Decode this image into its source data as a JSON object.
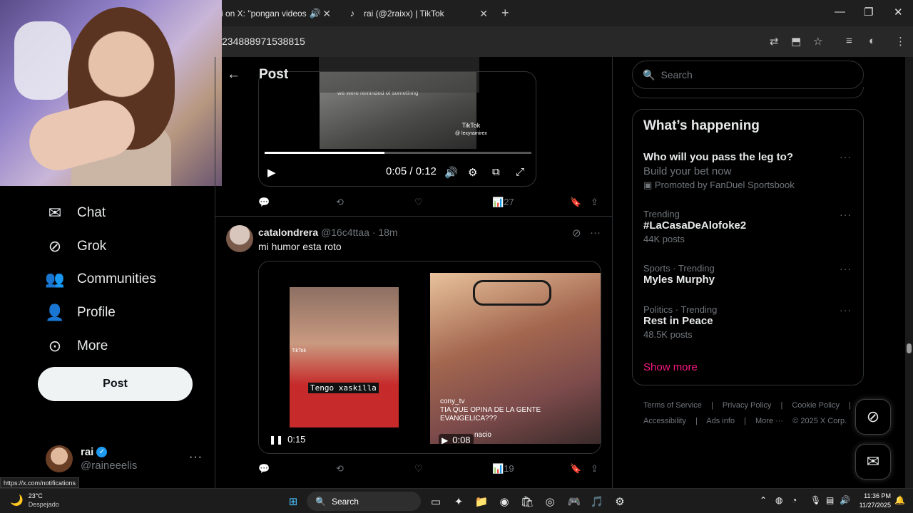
{
  "browser": {
    "tabs": [
      {
        "title": "i on X: \"pongan videos acá pa",
        "active": true
      },
      {
        "title": "rai (@2raixx) | TikTok",
        "active": false
      }
    ],
    "url": "234888971538815",
    "status_url": "https://x.com/notifications"
  },
  "nav": {
    "items": [
      {
        "label": "Chat",
        "icon": "mail-icon"
      },
      {
        "label": "Grok",
        "icon": "grok-icon"
      },
      {
        "label": "Communities",
        "icon": "people-icon"
      },
      {
        "label": "Profile",
        "icon": "person-icon"
      },
      {
        "label": "More",
        "icon": "more-circle-icon"
      }
    ],
    "post_button": "Post"
  },
  "account": {
    "name": "rai",
    "handle": "@raineeelis",
    "more": "···"
  },
  "header": {
    "title": "Post"
  },
  "tweet1": {
    "video": {
      "caption": "we were reminded of something",
      "tiktok_label": "TikTok",
      "tiktok_handle": "@ lexyramirex",
      "time": "0:05 / 0:12",
      "progress": 0.45
    },
    "views": "27"
  },
  "tweet2": {
    "username": "catalondrera",
    "handle": "@16c4ttaa",
    "time": "18m",
    "text": "mi humor esta roto",
    "media": {
      "left_label": "Tengo xaskilla",
      "left_tiktok": "TikTok",
      "left_duration": "0:15",
      "right_caption_user": "cony_tv",
      "right_caption": "TIA QUE OPINA DE LA GENTE EVANGELICA???",
      "right_nacio": "nacio",
      "right_duration": "0:08"
    },
    "views": "19"
  },
  "sidebar": {
    "search_placeholder": "Search",
    "trending_title": "What’s happening",
    "trends": [
      {
        "meta": "",
        "title": "Who will you pass the leg to?",
        "subtitle": "Build your bet now",
        "promo": "Promoted by FanDuel Sportsbook"
      },
      {
        "meta": "Trending",
        "title": "#LaCasaDeAlofoke2",
        "posts": "44K posts"
      },
      {
        "meta": "Sports · Trending",
        "title": "Myles Murphy",
        "posts": ""
      },
      {
        "meta": "Politics · Trending",
        "title": "Rest in Peace",
        "posts": "48.5K posts"
      }
    ],
    "show_more": "Show more",
    "footer": {
      "line1": [
        "Terms of Service",
        "|",
        "Privacy Policy",
        "|",
        "Cookie Policy",
        "|"
      ],
      "line2": [
        "Accessibility",
        "|",
        "Ads info",
        "|",
        "More ···",
        "© 2025 X Corp."
      ]
    }
  },
  "taskbar": {
    "weather_temp": "23°C",
    "weather_desc": "Despejado",
    "search": "Search",
    "time": "11:36 PM",
    "date": "11/27/2025"
  },
  "colors": {
    "accent_pink": "#f91880",
    "verified_blue": "#1d9bf0",
    "bg": "#000000",
    "muted": "#71767b"
  }
}
